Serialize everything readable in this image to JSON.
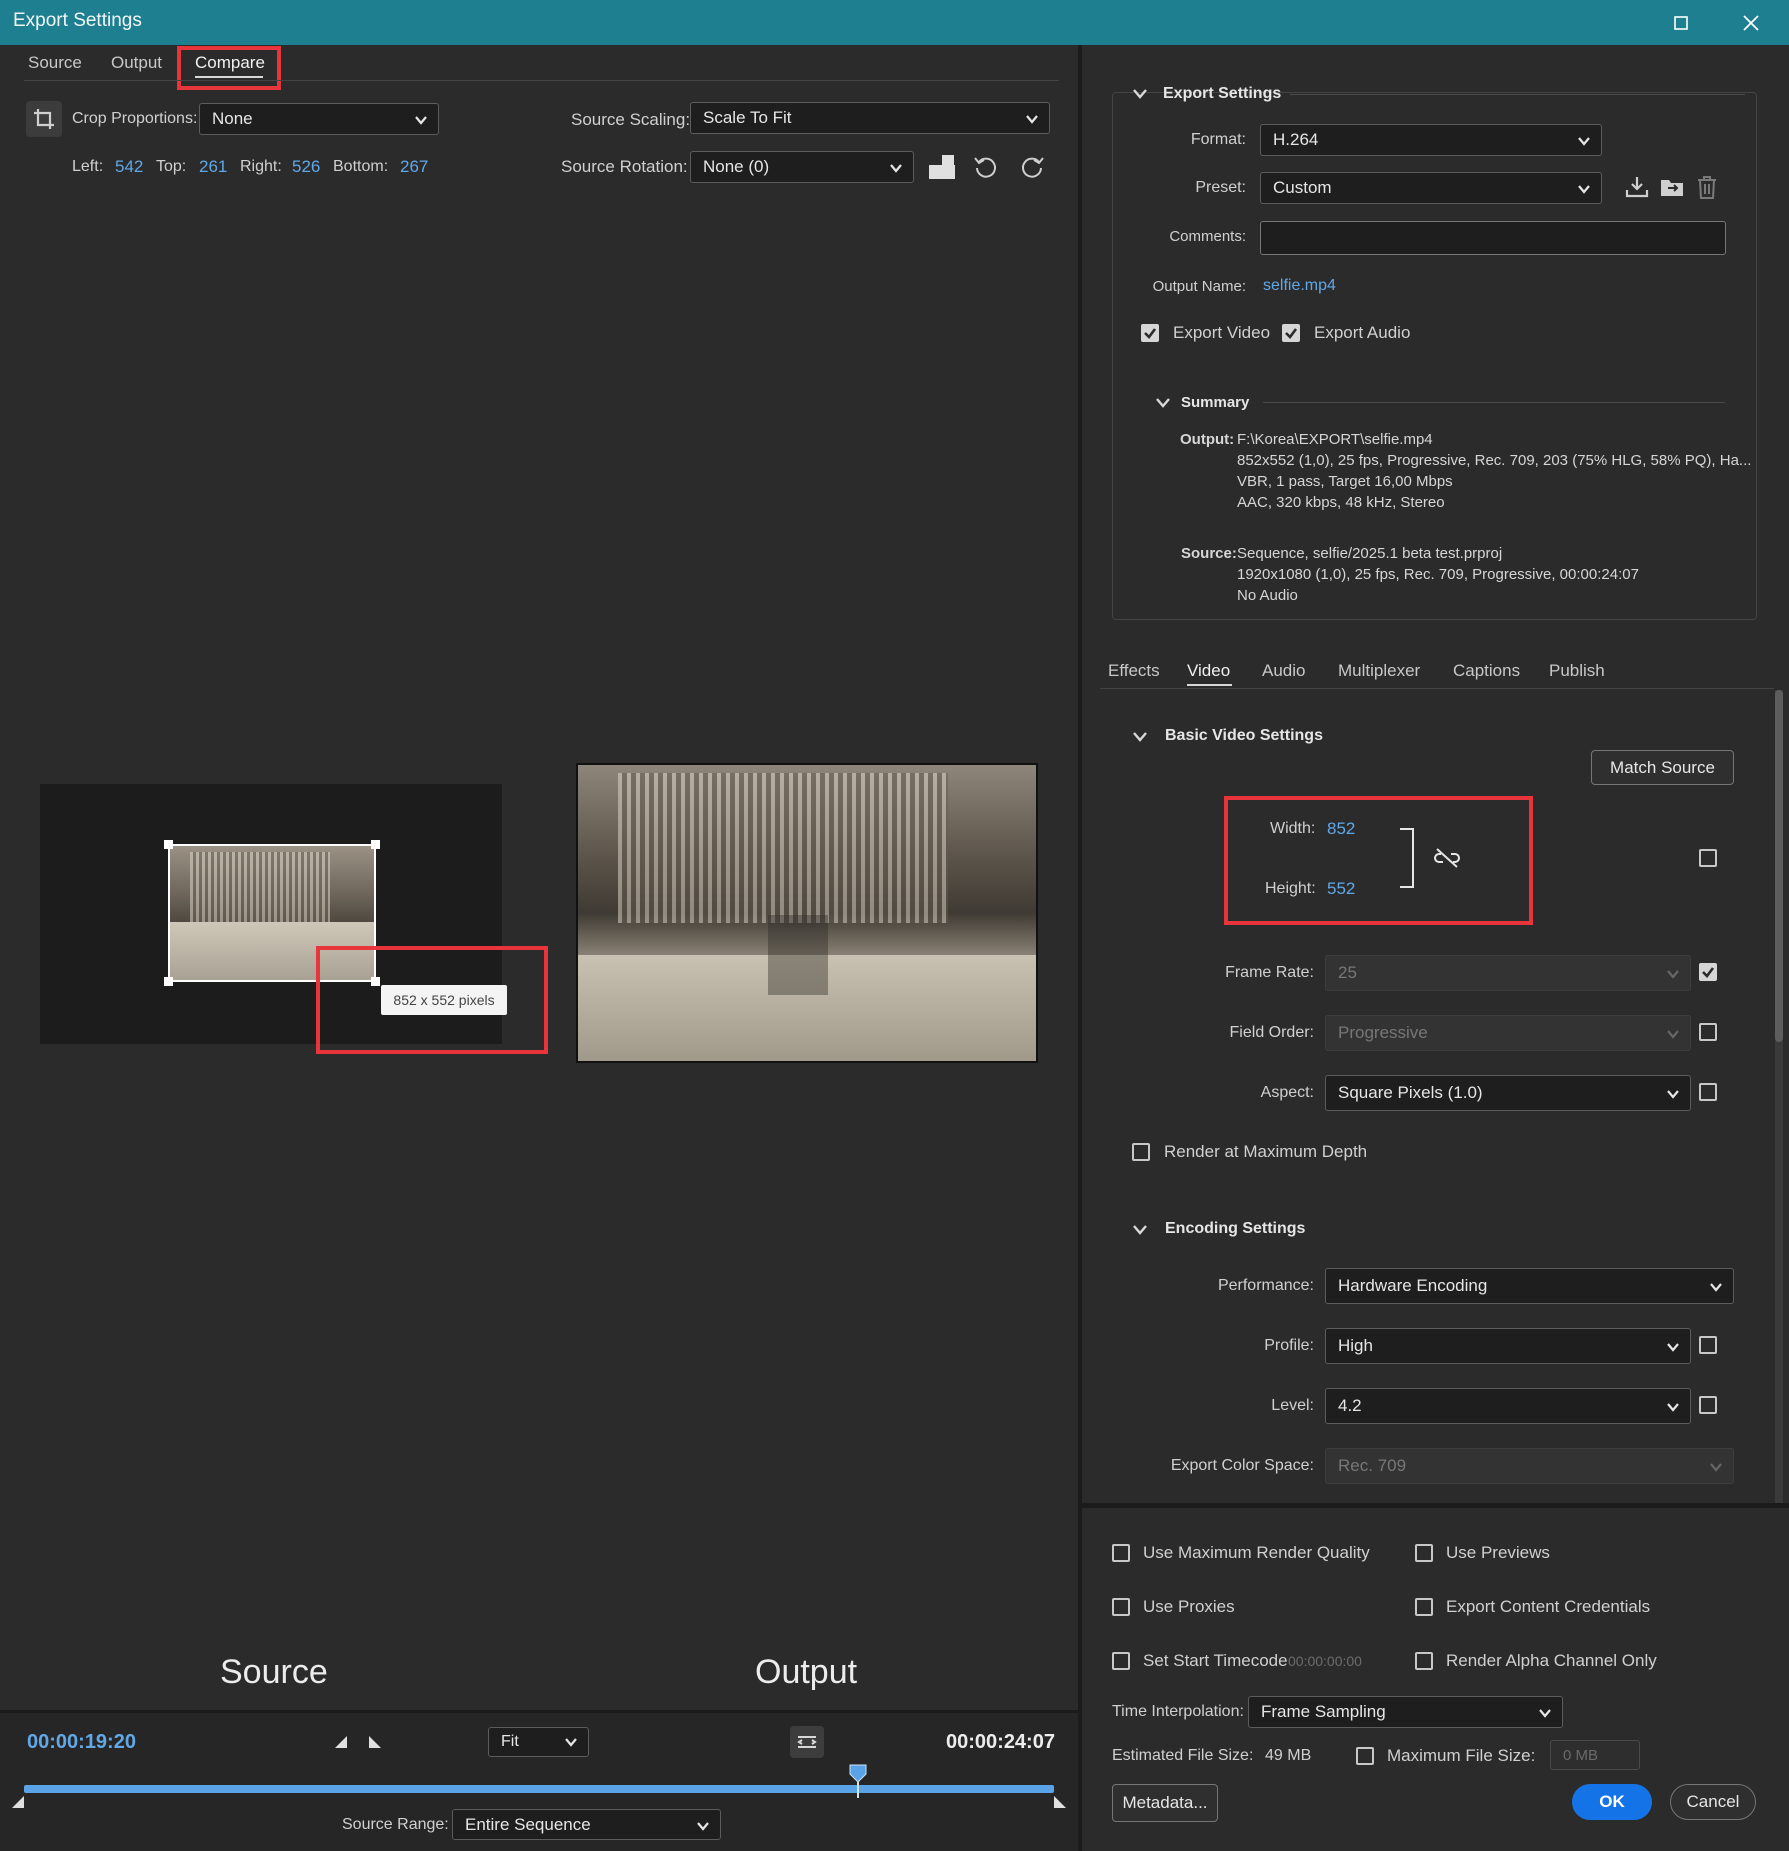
{
  "window": {
    "title": "Export Settings"
  },
  "left": {
    "tabs": [
      "Source",
      "Output",
      "Compare"
    ],
    "crop_label": "Crop Proportions:",
    "crop_value": "None",
    "source_scaling_label": "Source Scaling:",
    "source_scaling_value": "Scale To Fit",
    "crop": {
      "left_label": "Left:",
      "left": "542",
      "top_label": "Top:",
      "top": "261",
      "right_label": "Right:",
      "right": "526",
      "bottom_label": "Bottom:",
      "bottom": "267"
    },
    "source_rotation_label": "Source Rotation:",
    "source_rotation_value": "None (0)",
    "tooltip": "852 x 552 pixels",
    "source_caption": "Source",
    "output_caption": "Output",
    "timecode_current": "00:00:19:20",
    "timecode_duration": "00:00:24:07",
    "zoom_value": "Fit",
    "playhead_fraction": 0.81,
    "source_range_label": "Source Range:",
    "source_range_value": "Entire Sequence"
  },
  "export_settings": {
    "header": "Export Settings",
    "format_label": "Format:",
    "format_value": "H.264",
    "preset_label": "Preset:",
    "preset_value": "Custom",
    "comments_label": "Comments:",
    "comments_value": "",
    "output_name_label": "Output Name:",
    "output_name_value": "selfie.mp4",
    "export_video_label": "Export Video",
    "export_audio_label": "Export Audio",
    "summary": {
      "header": "Summary",
      "output_label": "Output:",
      "output_lines": [
        "F:\\Korea\\EXPORT\\selfie.mp4",
        "852x552 (1,0), 25 fps, Progressive, Rec. 709, 203 (75% HLG, 58% PQ), Ha...",
        "VBR, 1 pass, Target 16,00 Mbps",
        "AAC, 320 kbps, 48 kHz, Stereo"
      ],
      "source_label": "Source:",
      "source_lines": [
        "Sequence, selfie/2025.1 beta test.prproj",
        "1920x1080 (1,0), 25 fps, Rec. 709, Progressive, 00:00:24:07",
        "No Audio"
      ]
    }
  },
  "panel_tabs": [
    "Effects",
    "Video",
    "Audio",
    "Multiplexer",
    "Captions",
    "Publish"
  ],
  "video": {
    "basic_header": "Basic Video Settings",
    "match_source": "Match Source",
    "width_label": "Width:",
    "width_value": "852",
    "height_label": "Height:",
    "height_value": "552",
    "frame_rate_label": "Frame Rate:",
    "frame_rate_value": "25",
    "field_order_label": "Field Order:",
    "field_order_value": "Progressive",
    "aspect_label": "Aspect:",
    "aspect_value": "Square Pixels (1.0)",
    "render_max_depth": "Render at Maximum Depth",
    "encoding_header": "Encoding Settings",
    "performance_label": "Performance:",
    "performance_value": "Hardware Encoding",
    "profile_label": "Profile:",
    "profile_value": "High",
    "level_label": "Level:",
    "level_value": "4.2",
    "color_space_label": "Export Color Space:",
    "color_space_value": "Rec. 709"
  },
  "bottom": {
    "use_max_render": "Use Maximum Render Quality",
    "use_previews": "Use Previews",
    "use_proxies": "Use Proxies",
    "export_credentials": "Export Content Credentials",
    "set_start_tc": "Set Start Timecode",
    "start_tc_value": "00:00:00:00",
    "render_alpha": "Render Alpha Channel Only",
    "time_interp_label": "Time Interpolation:",
    "time_interp_value": "Frame Sampling",
    "est_size_label": "Estimated File Size:",
    "est_size_value": "49 MB",
    "max_size_label": "Maximum File Size:",
    "max_size_value": "0 MB",
    "metadata": "Metadata...",
    "ok": "OK",
    "cancel": "Cancel"
  },
  "colors": {
    "titlebar": "#1d7f90",
    "accent_blue": "#61a8e8",
    "highlight_red": "#e8343b",
    "ok_blue": "#1473e6"
  }
}
